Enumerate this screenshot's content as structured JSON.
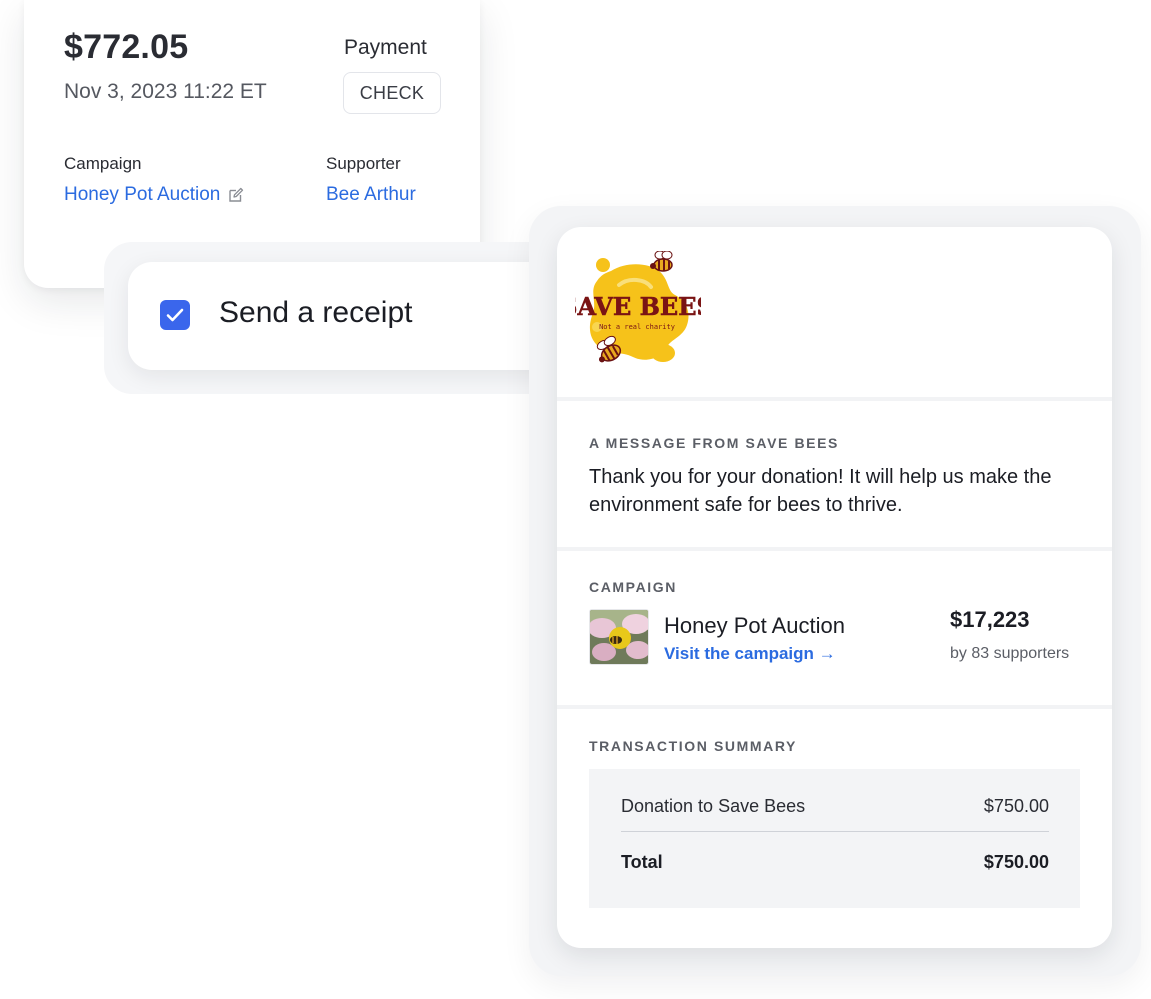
{
  "payment_card": {
    "amount": "$772.05",
    "datetime": "Nov 3, 2023 11:22 ET",
    "payment_label": "Payment",
    "payment_method": "CHECK",
    "campaign_label": "Campaign",
    "campaign_value": "Honey Pot Auction",
    "supporter_label": "Supporter",
    "supporter_value": "Bee Arthur"
  },
  "receipt_option": {
    "label": "Send a receipt",
    "checked": true
  },
  "email_preview": {
    "logo": {
      "title": "SAVE BEES",
      "tagline": "Not a real charity"
    },
    "message_heading": "A MESSAGE FROM SAVE BEES",
    "message_body": "Thank you for your donation! It will help us make the environment safe for bees to thrive.",
    "campaign_heading": "CAMPAIGN",
    "campaign_name": "Honey Pot Auction",
    "campaign_link": "Visit the campaign →",
    "campaign_total": "$17,223",
    "campaign_supporters": "by 83 supporters",
    "summary_heading": "TRANSACTION SUMMARY",
    "summary_rows": [
      {
        "label": "Donation to Save Bees",
        "amount": "$750.00"
      }
    ],
    "total_label": "Total",
    "total_amount": "$750.00"
  },
  "colors": {
    "link": "#2b6be0",
    "checkbox": "#3a66ec",
    "logo_yellow": "#f6c21a",
    "logo_text": "#7a1414"
  }
}
